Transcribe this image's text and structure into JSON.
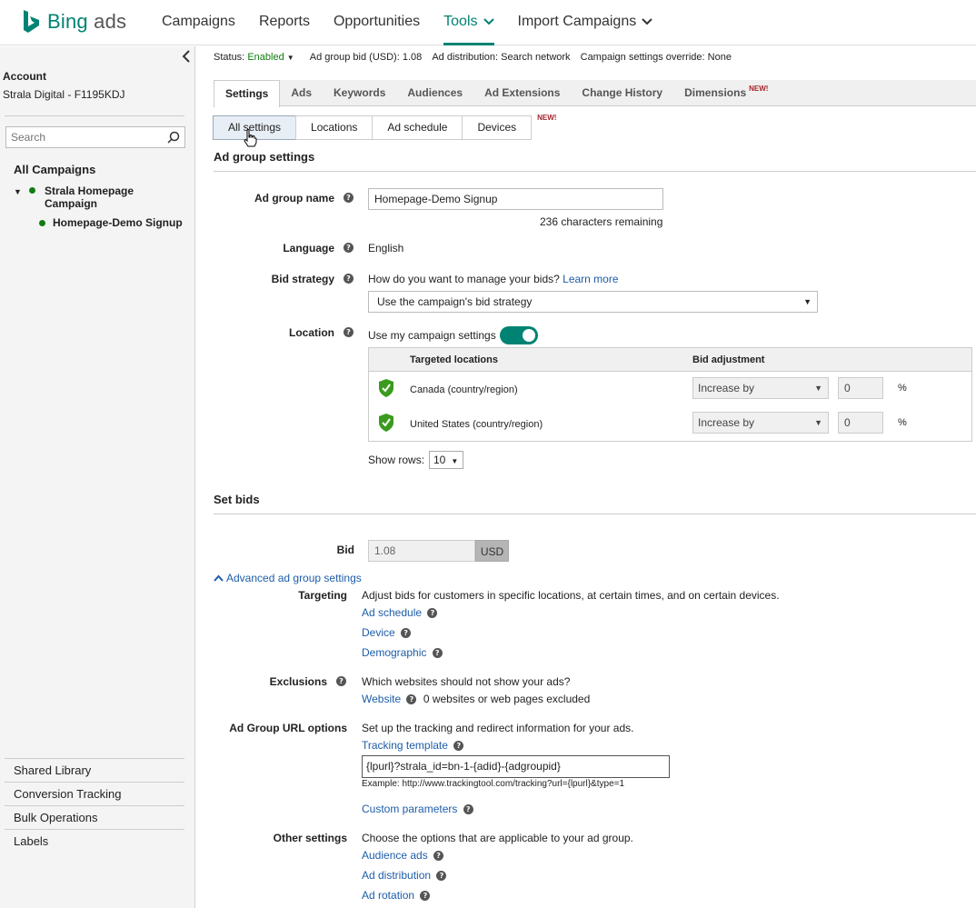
{
  "brand": {
    "name_part1": "Bing",
    "name_part2": " ads",
    "colors": {
      "accent": "#008373",
      "link": "#1e5da8",
      "new_badge": "#a4262c",
      "status_green": "#107c10"
    }
  },
  "nav": {
    "items": [
      "Campaigns",
      "Reports",
      "Opportunities",
      "Tools",
      "Import Campaigns"
    ],
    "active": "Tools"
  },
  "sidebar": {
    "account_label": "Account",
    "account_name": "Strala Digital - F1195KDJ",
    "search_placeholder": "Search",
    "all_campaigns": "All Campaigns",
    "campaign": "Strala Homepage Campaign",
    "ad_group": "Homepage-Demo Signup",
    "bottom_links": [
      "Shared Library",
      "Conversion Tracking",
      "Bulk Operations",
      "Labels"
    ]
  },
  "statusbar": {
    "status_label": "Status:",
    "status_value": "Enabled",
    "bid_text": "Ad group bid (USD): 1.08",
    "distribution_text": "Ad distribution: Search network",
    "override_text": "Campaign settings override: None"
  },
  "tabs": {
    "items": [
      "Settings",
      "Ads",
      "Keywords",
      "Audiences",
      "Ad Extensions",
      "Change History",
      "Dimensions"
    ],
    "new_badge": "NEW!"
  },
  "subtabs": {
    "items": [
      "All settings",
      "Locations",
      "Ad schedule",
      "Devices"
    ],
    "new_badge": "NEW!"
  },
  "ad_group_settings": {
    "title": "Ad group settings",
    "name_label": "Ad group name",
    "name_value": "Homepage-Demo Signup",
    "chars_remaining": "236 characters remaining",
    "language_label": "Language",
    "language_value": "English",
    "bid_strategy_label": "Bid strategy",
    "bid_strategy_question": "How do you want to manage your bids?",
    "learn_more": "Learn more",
    "bid_strategy_value": "Use the campaign's bid strategy",
    "location_label": "Location",
    "use_campaign_settings": "Use my campaign settings",
    "location_toggle_on": true,
    "loc_table": {
      "col_targeted": "Targeted locations",
      "col_bid": "Bid adjustment",
      "rows": [
        {
          "name": "Canada (country/region)",
          "adjust": "Increase by",
          "value": "0",
          "unit": "%"
        },
        {
          "name": "United States (country/region)",
          "adjust": "Increase by",
          "value": "0",
          "unit": "%"
        }
      ]
    },
    "show_rows_label": "Show rows:",
    "show_rows_value": "10"
  },
  "set_bids": {
    "title": "Set bids",
    "bid_label": "Bid",
    "bid_value": "1.08",
    "currency": "USD"
  },
  "advanced": {
    "toggle_label": "Advanced ad group settings",
    "targeting_label": "Targeting",
    "targeting_desc": "Adjust bids for customers in specific locations, at certain times, and on certain devices.",
    "targeting_links": [
      "Ad schedule",
      "Device",
      "Demographic"
    ],
    "exclusions_label": "Exclusions",
    "exclusions_desc": "Which websites should not show your ads?",
    "website_link": "Website",
    "website_excluded": "0 websites or web pages excluded",
    "url_options_label": "Ad Group URL options",
    "url_options_desc": "Set up the tracking and redirect information for your ads.",
    "tracking_template_link": "Tracking template",
    "tracking_template_value": "{lpurl}?strala_id=bn-1-{adid}-{adgroupid}",
    "example": "Example: http://www.trackingtool.com/tracking?url={lpurl}&type=1",
    "custom_params_link": "Custom parameters",
    "other_label": "Other settings",
    "other_desc": "Choose the options that are applicable to your ad group.",
    "other_links": [
      "Audience ads",
      "Ad distribution",
      "Ad rotation"
    ]
  }
}
